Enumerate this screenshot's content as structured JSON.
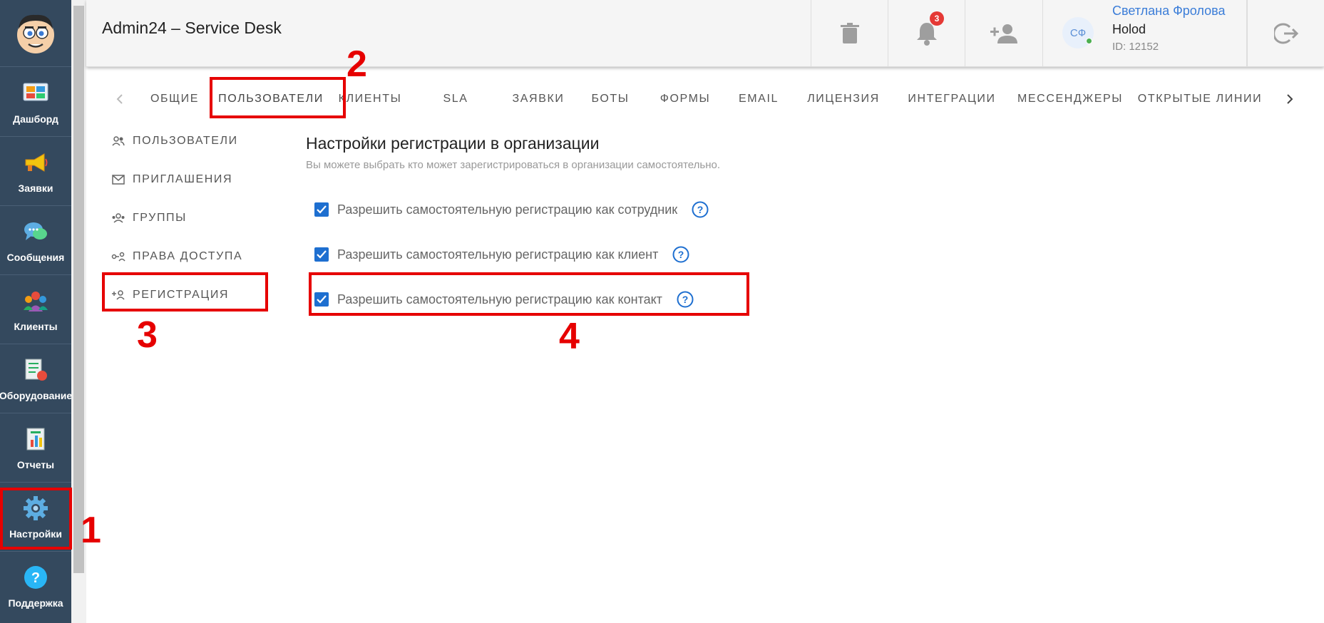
{
  "app": {
    "title": "Admin24 – Service Desk"
  },
  "sidebar": {
    "items": [
      {
        "label": "Дашборд",
        "icon": "dashboard-icon"
      },
      {
        "label": "Заявки",
        "icon": "megaphone-icon"
      },
      {
        "label": "Сообщения",
        "icon": "chat-icon"
      },
      {
        "label": "Клиенты",
        "icon": "clients-icon"
      },
      {
        "label": "Оборудование",
        "icon": "equipment-icon"
      },
      {
        "label": "Отчеты",
        "icon": "reports-icon"
      },
      {
        "label": "Настройки",
        "icon": "gear-icon"
      },
      {
        "label": "Поддержка",
        "icon": "help-icon"
      }
    ]
  },
  "header": {
    "notifications_count": "3",
    "user": {
      "initials": "СФ",
      "name": "Светлана Фролова",
      "org": "Holod",
      "id": "ID: 12152"
    }
  },
  "tabs": [
    "ОБЩИЕ",
    "ПОЛЬЗОВАТЕЛИ",
    "КЛИЕНТЫ",
    "SLA",
    "ЗАЯВКИ",
    "БОТЫ",
    "ФОРМЫ",
    "EMAIL",
    "ЛИЦЕНЗИЯ",
    "ИНТЕГРАЦИИ",
    "МЕССЕНДЖЕРЫ",
    "ОТКРЫТЫЕ ЛИНИИ"
  ],
  "subnav": [
    "ПОЛЬЗОВАТЕЛИ",
    "ПРИГЛАШЕНИЯ",
    "ГРУППЫ",
    "ПРАВА ДОСТУПА",
    "РЕГИСТРАЦИЯ"
  ],
  "content": {
    "title": "Настройки регистрации в организации",
    "description": "Вы можете выбрать кто может зарегистрироваться в организации самостоятельно.",
    "options": [
      {
        "label": "Разрешить самостоятельную регистрацию как сотрудник",
        "checked": true
      },
      {
        "label": "Разрешить самостоятельную регистрацию как клиент",
        "checked": true
      },
      {
        "label": "Разрешить самостоятельную регистрацию как контакт",
        "checked": true
      }
    ]
  },
  "annotations": [
    "1",
    "2",
    "3",
    "4"
  ],
  "colors": {
    "accent": "#1e6fd0",
    "sidebar": "#34495e",
    "annotation": "#e60000",
    "link": "#3b7dd8"
  }
}
